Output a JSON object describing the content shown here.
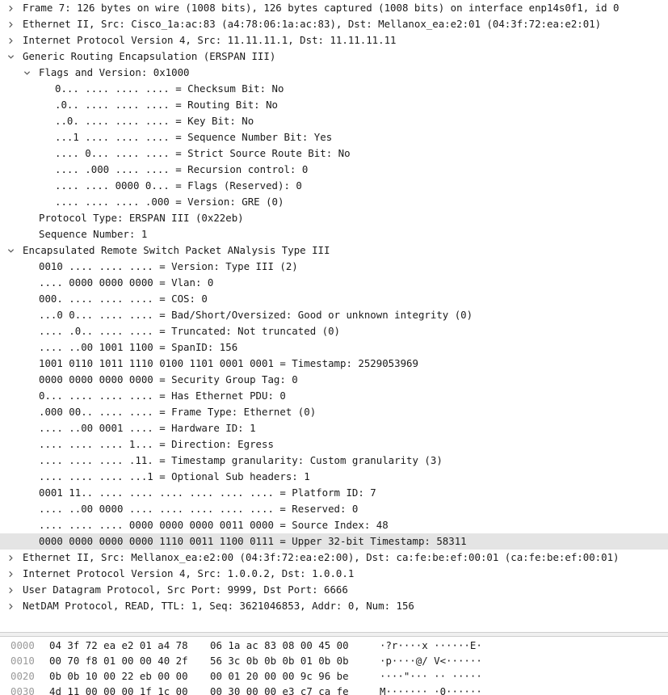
{
  "tree": [
    {
      "level": 0,
      "toggle": "collapsed",
      "text": "Frame 7: 126 bytes on wire (1008 bits), 126 bytes captured (1008 bits) on interface enp14s0f1, id 0"
    },
    {
      "level": 0,
      "toggle": "collapsed",
      "text": "Ethernet II, Src: Cisco_1a:ac:83 (a4:78:06:1a:ac:83), Dst: Mellanox_ea:e2:01 (04:3f:72:ea:e2:01)"
    },
    {
      "level": 0,
      "toggle": "collapsed",
      "text": "Internet Protocol Version 4, Src: 11.11.11.1, Dst: 11.11.11.11"
    },
    {
      "level": 0,
      "toggle": "expanded",
      "text": "Generic Routing Encapsulation (ERSPAN III)"
    },
    {
      "level": 1,
      "toggle": "expanded",
      "text": "Flags and Version: 0x1000"
    },
    {
      "level": 2,
      "toggle": "none",
      "text": "0... .... .... .... = Checksum Bit: No"
    },
    {
      "level": 2,
      "toggle": "none",
      "text": ".0.. .... .... .... = Routing Bit: No"
    },
    {
      "level": 2,
      "toggle": "none",
      "text": "..0. .... .... .... = Key Bit: No"
    },
    {
      "level": 2,
      "toggle": "none",
      "text": "...1 .... .... .... = Sequence Number Bit: Yes"
    },
    {
      "level": 2,
      "toggle": "none",
      "text": ".... 0... .... .... = Strict Source Route Bit: No"
    },
    {
      "level": 2,
      "toggle": "none",
      "text": ".... .000 .... .... = Recursion control: 0"
    },
    {
      "level": 2,
      "toggle": "none",
      "text": ".... .... 0000 0... = Flags (Reserved): 0"
    },
    {
      "level": 2,
      "toggle": "none",
      "text": ".... .... .... .000 = Version: GRE (0)"
    },
    {
      "level": 1,
      "toggle": "none",
      "text": "Protocol Type: ERSPAN III (0x22eb)"
    },
    {
      "level": 1,
      "toggle": "none",
      "text": "Sequence Number: 1"
    },
    {
      "level": 0,
      "toggle": "expanded",
      "text": "Encapsulated Remote Switch Packet ANalysis Type III"
    },
    {
      "level": 1,
      "toggle": "none",
      "text": "0010 .... .... .... = Version: Type III (2)"
    },
    {
      "level": 1,
      "toggle": "none",
      "text": ".... 0000 0000 0000 = Vlan: 0"
    },
    {
      "level": 1,
      "toggle": "none",
      "text": "000. .... .... .... = COS: 0"
    },
    {
      "level": 1,
      "toggle": "none",
      "text": "...0 0... .... .... = Bad/Short/Oversized: Good or unknown integrity (0)"
    },
    {
      "level": 1,
      "toggle": "none",
      "text": ".... .0.. .... .... = Truncated: Not truncated (0)"
    },
    {
      "level": 1,
      "toggle": "none",
      "text": ".... ..00 1001 1100 = SpanID: 156"
    },
    {
      "level": 1,
      "toggle": "none",
      "text": "1001 0110 1011 1110 0100 1101 0001 0001 = Timestamp: 2529053969"
    },
    {
      "level": 1,
      "toggle": "none",
      "text": "0000 0000 0000 0000 = Security Group Tag: 0"
    },
    {
      "level": 1,
      "toggle": "none",
      "text": "0... .... .... .... = Has Ethernet PDU: 0"
    },
    {
      "level": 1,
      "toggle": "none",
      "text": ".000 00.. .... .... = Frame Type: Ethernet (0)"
    },
    {
      "level": 1,
      "toggle": "none",
      "text": ".... ..00 0001 .... = Hardware ID: 1"
    },
    {
      "level": 1,
      "toggle": "none",
      "text": ".... .... .... 1... = Direction: Egress"
    },
    {
      "level": 1,
      "toggle": "none",
      "text": ".... .... .... .11. = Timestamp granularity: Custom granularity (3)"
    },
    {
      "level": 1,
      "toggle": "none",
      "text": ".... .... .... ...1 = Optional Sub headers: 1"
    },
    {
      "level": 1,
      "toggle": "none",
      "text": "0001 11.. .... .... .... .... .... .... = Platform ID: 7"
    },
    {
      "level": 1,
      "toggle": "none",
      "text": ".... ..00 0000 .... .... .... .... .... = Reserved: 0"
    },
    {
      "level": 1,
      "toggle": "none",
      "text": ".... .... .... 0000 0000 0000 0011 0000 = Source Index: 48"
    },
    {
      "level": 1,
      "toggle": "none",
      "selected": true,
      "text": "0000 0000 0000 0000 1110 0011 1100 0111 = Upper 32-bit Timestamp: 58311"
    },
    {
      "level": 0,
      "toggle": "collapsed",
      "text": "Ethernet II, Src: Mellanox_ea:e2:00 (04:3f:72:ea:e2:00), Dst: ca:fe:be:ef:00:01 (ca:fe:be:ef:00:01)"
    },
    {
      "level": 0,
      "toggle": "collapsed",
      "text": "Internet Protocol Version 4, Src: 1.0.0.2, Dst: 1.0.0.1"
    },
    {
      "level": 0,
      "toggle": "collapsed",
      "text": "User Datagram Protocol, Src Port: 9999, Dst Port: 6666"
    },
    {
      "level": 0,
      "toggle": "collapsed",
      "text": "NetDAM Protocol, READ, TTL: 1, Seq: 3621046853, Addr: 0, Num: 156"
    }
  ],
  "bytes": [
    {
      "offset": "0000",
      "hex1": "04 3f 72 ea e2 01 a4 78",
      "hex2": "06 1a ac 83 08 00 45 00",
      "ascii": "·?r····x ······E·"
    },
    {
      "offset": "0010",
      "hex1": "00 70 f8 01 00 00 40 2f",
      "hex2": "56 3c 0b 0b 0b 01 0b 0b",
      "ascii": "·p····@/ V<······"
    },
    {
      "offset": "0020",
      "hex1": "0b 0b 10 00 22 eb 00 00",
      "hex2": "00 01 20 00 00 9c 96 be",
      "ascii": "····\"··· ·· ·····"
    },
    {
      "offset": "0030",
      "hex1": "4d 11 00 00 00 1f 1c 00",
      "hex2": "00 30 00 00 e3 c7 ca fe",
      "ascii": "M······· ·0······"
    }
  ],
  "colors": {
    "text": "#1a1a1a",
    "selected_row": "#e4e4e4",
    "offset": "#9a9a9a",
    "chevron": "#555555"
  }
}
